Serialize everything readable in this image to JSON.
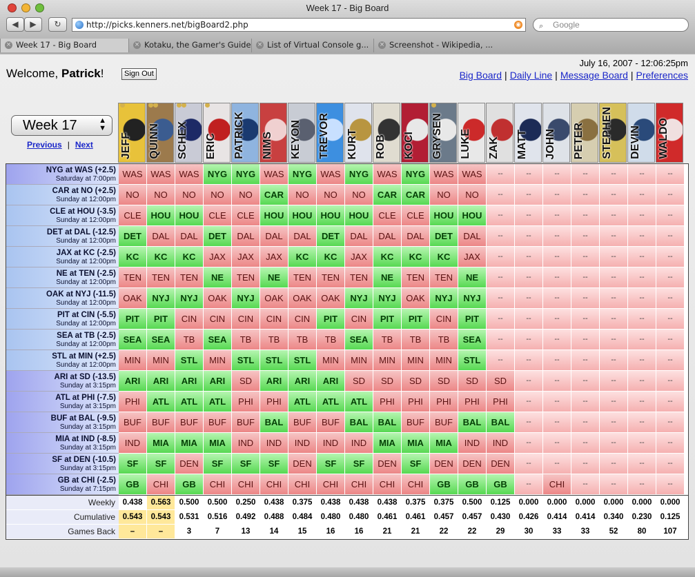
{
  "window": {
    "title": "Week 17 - Big Board"
  },
  "toolbar": {
    "back": "◀",
    "forward": "▶",
    "reload": "↻"
  },
  "address": {
    "url": "http://picks.kenners.net/bigBoard2.php"
  },
  "search": {
    "placeholder": "Google"
  },
  "tabs": [
    {
      "label": "Week 17 - Big Board"
    },
    {
      "label": "Kotaku, the Gamer's Guide"
    },
    {
      "label": "List of Virtual Console g..."
    },
    {
      "label": "Screenshot - Wikipedia, ..."
    }
  ],
  "header": {
    "welcome_prefix": "Welcome, ",
    "user": "Patrick",
    "welcome_suffix": "!",
    "signout": "Sign Out",
    "datetime": "July 16, 2007 - 12:06:25pm",
    "nav": [
      "Big Board",
      "Daily Line",
      "Message Board",
      "Preferences"
    ]
  },
  "week": {
    "selected": "Week 17",
    "prev": "Previous",
    "next": "Next"
  },
  "players": [
    {
      "name": "JEFF",
      "bg": "#e8c23a",
      "accent": "#222222"
    },
    {
      "name": "QUINN",
      "bg": "#9c7a4c",
      "accent": "#3b5c90"
    },
    {
      "name": "SCHEX",
      "bg": "#c9cbd6",
      "accent": "#1d2a66"
    },
    {
      "name": "ERIC",
      "bg": "#e8e4e4",
      "accent": "#c02020"
    },
    {
      "name": "PATRICK",
      "bg": "#8fb4df",
      "accent": "#1a3a70"
    },
    {
      "name": "NIMS",
      "bg": "#c84040",
      "accent": "#f0d0d0"
    },
    {
      "name": "KEYON",
      "bg": "#c8ccd4",
      "accent": "#5a6070"
    },
    {
      "name": "TREVOR",
      "bg": "#3d8fe0",
      "accent": "#c8e0ff"
    },
    {
      "name": "KURT",
      "bg": "#dfe3ec",
      "accent": "#b89540"
    },
    {
      "name": "ROB",
      "bg": "#e0dcd0",
      "accent": "#333333"
    },
    {
      "name": "KOCI",
      "bg": "#b21e34",
      "accent": "#e8e8e8"
    },
    {
      "name": "GRYSEN",
      "bg": "#6b7a8a",
      "accent": "#e8e8e8"
    },
    {
      "name": "LUKE",
      "bg": "#e8e8e8",
      "accent": "#cc2a2a"
    },
    {
      "name": "ZAK",
      "bg": "#e0e0e0",
      "accent": "#c03030"
    },
    {
      "name": "MATT",
      "bg": "#e0e4ec",
      "accent": "#1c2b56"
    },
    {
      "name": "JOHN",
      "bg": "#dee2e8",
      "accent": "#3a4a6c"
    },
    {
      "name": "PETER",
      "bg": "#d6ceb0",
      "accent": "#8a7040"
    },
    {
      "name": "STEPHEN",
      "bg": "#d6c05a",
      "accent": "#2a2a2a"
    },
    {
      "name": "DEVIN",
      "bg": "#d0dcea",
      "accent": "#2a4a7a"
    },
    {
      "name": "WALDO",
      "bg": "#d02a2a",
      "accent": "#f0e0e0"
    }
  ],
  "games": [
    {
      "matchup": "NYG at WAS (+2.5)",
      "time": "Saturday at 7:00pm",
      "picks": [
        "WAS",
        "WAS",
        "WAS",
        "NYG",
        "NYG",
        "WAS",
        "NYG",
        "WAS",
        "NYG",
        "WAS",
        "NYG",
        "WAS",
        "WAS",
        "--",
        "--",
        "--",
        "--",
        "--",
        "--",
        "--"
      ],
      "winner": "NYG"
    },
    {
      "matchup": "CAR at NO (+2.5)",
      "time": "Sunday at 12:00pm",
      "picks": [
        "NO",
        "NO",
        "NO",
        "NO",
        "NO",
        "CAR",
        "NO",
        "NO",
        "NO",
        "CAR",
        "CAR",
        "NO",
        "NO",
        "--",
        "--",
        "--",
        "--",
        "--",
        "--",
        "--"
      ],
      "winner": "CAR"
    },
    {
      "matchup": "CLE at HOU (-3.5)",
      "time": "Sunday at 12:00pm",
      "picks": [
        "CLE",
        "HOU",
        "HOU",
        "CLE",
        "CLE",
        "HOU",
        "HOU",
        "HOU",
        "HOU",
        "CLE",
        "CLE",
        "HOU",
        "HOU",
        "--",
        "--",
        "--",
        "--",
        "--",
        "--",
        "--"
      ],
      "winner": "HOU"
    },
    {
      "matchup": "DET at DAL (-12.5)",
      "time": "Sunday at 12:00pm",
      "picks": [
        "DET",
        "DAL",
        "DAL",
        "DET",
        "DAL",
        "DAL",
        "DAL",
        "DET",
        "DAL",
        "DAL",
        "DAL",
        "DET",
        "DAL",
        "--",
        "--",
        "--",
        "--",
        "--",
        "--",
        "--"
      ],
      "winner": "DET"
    },
    {
      "matchup": "JAX at KC (-2.5)",
      "time": "Sunday at 12:00pm",
      "picks": [
        "KC",
        "KC",
        "KC",
        "JAX",
        "JAX",
        "JAX",
        "KC",
        "KC",
        "JAX",
        "KC",
        "KC",
        "KC",
        "JAX",
        "--",
        "--",
        "--",
        "--",
        "--",
        "--",
        "--"
      ],
      "winner": "KC"
    },
    {
      "matchup": "NE at TEN (-2.5)",
      "time": "Sunday at 12:00pm",
      "picks": [
        "TEN",
        "TEN",
        "TEN",
        "NE",
        "TEN",
        "NE",
        "TEN",
        "TEN",
        "TEN",
        "NE",
        "TEN",
        "TEN",
        "NE",
        "--",
        "--",
        "--",
        "--",
        "--",
        "--",
        "--"
      ],
      "winner": "NE"
    },
    {
      "matchup": "OAK at NYJ (-11.5)",
      "time": "Sunday at 12:00pm",
      "picks": [
        "OAK",
        "NYJ",
        "NYJ",
        "OAK",
        "NYJ",
        "OAK",
        "OAK",
        "OAK",
        "NYJ",
        "NYJ",
        "OAK",
        "NYJ",
        "NYJ",
        "--",
        "--",
        "--",
        "--",
        "--",
        "--",
        "--"
      ],
      "winner": "NYJ"
    },
    {
      "matchup": "PIT at CIN (-5.5)",
      "time": "Sunday at 12:00pm",
      "picks": [
        "PIT",
        "PIT",
        "CIN",
        "CIN",
        "CIN",
        "CIN",
        "CIN",
        "PIT",
        "CIN",
        "PIT",
        "PIT",
        "CIN",
        "PIT",
        "--",
        "--",
        "--",
        "--",
        "--",
        "--",
        "--"
      ],
      "winner": "PIT"
    },
    {
      "matchup": "SEA at TB (-2.5)",
      "time": "Sunday at 12:00pm",
      "picks": [
        "SEA",
        "SEA",
        "TB",
        "SEA",
        "TB",
        "TB",
        "TB",
        "TB",
        "SEA",
        "TB",
        "TB",
        "TB",
        "SEA",
        "--",
        "--",
        "--",
        "--",
        "--",
        "--",
        "--"
      ],
      "winner": "SEA"
    },
    {
      "matchup": "STL at MIN (+2.5)",
      "time": "Sunday at 12:00pm",
      "picks": [
        "MIN",
        "MIN",
        "STL",
        "MIN",
        "STL",
        "STL",
        "STL",
        "MIN",
        "MIN",
        "MIN",
        "MIN",
        "MIN",
        "STL",
        "--",
        "--",
        "--",
        "--",
        "--",
        "--",
        "--"
      ],
      "winner": "STL"
    },
    {
      "matchup": "ARI at SD (-13.5)",
      "time": "Sunday at 3:15pm",
      "picks": [
        "ARI",
        "ARI",
        "ARI",
        "ARI",
        "SD",
        "ARI",
        "ARI",
        "ARI",
        "SD",
        "SD",
        "SD",
        "SD",
        "SD",
        "SD",
        "--",
        "--",
        "--",
        "--",
        "--",
        "--"
      ],
      "winner": "ARI"
    },
    {
      "matchup": "ATL at PHI (-7.5)",
      "time": "Sunday at 3:15pm",
      "picks": [
        "PHI",
        "ATL",
        "ATL",
        "ATL",
        "PHI",
        "PHI",
        "ATL",
        "ATL",
        "ATL",
        "PHI",
        "PHI",
        "PHI",
        "PHI",
        "PHI",
        "--",
        "--",
        "--",
        "--",
        "--",
        "--"
      ],
      "winner": "ATL"
    },
    {
      "matchup": "BUF at BAL (-9.5)",
      "time": "Sunday at 3:15pm",
      "picks": [
        "BUF",
        "BUF",
        "BUF",
        "BUF",
        "BUF",
        "BAL",
        "BUF",
        "BUF",
        "BAL",
        "BAL",
        "BUF",
        "BUF",
        "BAL",
        "BAL",
        "--",
        "--",
        "--",
        "--",
        "--",
        "--"
      ],
      "winner": "BAL"
    },
    {
      "matchup": "MIA at IND (-8.5)",
      "time": "Sunday at 3:15pm",
      "picks": [
        "IND",
        "MIA",
        "MIA",
        "MIA",
        "IND",
        "IND",
        "IND",
        "IND",
        "IND",
        "MIA",
        "MIA",
        "MIA",
        "IND",
        "IND",
        "--",
        "--",
        "--",
        "--",
        "--",
        "--"
      ],
      "winner": "MIA"
    },
    {
      "matchup": "SF at DEN (-10.5)",
      "time": "Sunday at 3:15pm",
      "picks": [
        "SF",
        "SF",
        "DEN",
        "SF",
        "SF",
        "SF",
        "DEN",
        "SF",
        "SF",
        "DEN",
        "SF",
        "DEN",
        "DEN",
        "DEN",
        "--",
        "--",
        "--",
        "--",
        "--",
        "--"
      ],
      "winner": "SF"
    },
    {
      "matchup": "GB at CHI (-2.5)",
      "time": "Sunday at 7:15pm",
      "picks": [
        "GB",
        "CHI",
        "GB",
        "CHI",
        "CHI",
        "CHI",
        "CHI",
        "CHI",
        "CHI",
        "CHI",
        "CHI",
        "GB",
        "GB",
        "GB",
        "--",
        "CHI",
        "--",
        "--",
        "--",
        "--"
      ],
      "winner": "GB"
    }
  ],
  "stats": {
    "weekly_label": "Weekly",
    "cumulative_label": "Cumulative",
    "games_back_label": "Games Back",
    "weekly": [
      "0.438",
      "0.563",
      "0.500",
      "0.500",
      "0.250",
      "0.438",
      "0.375",
      "0.438",
      "0.438",
      "0.438",
      "0.375",
      "0.375",
      "0.500",
      "0.125",
      "0.000",
      "0.000",
      "0.000",
      "0.000",
      "0.000",
      "0.000"
    ],
    "cumulative": [
      "0.543",
      "0.543",
      "0.531",
      "0.516",
      "0.492",
      "0.488",
      "0.484",
      "0.480",
      "0.480",
      "0.461",
      "0.461",
      "0.457",
      "0.457",
      "0.430",
      "0.426",
      "0.414",
      "0.414",
      "0.340",
      "0.230",
      "0.125"
    ],
    "games_back": [
      "–",
      "–",
      "3",
      "7",
      "13",
      "14",
      "15",
      "16",
      "16",
      "21",
      "21",
      "22",
      "22",
      "29",
      "30",
      "33",
      "33",
      "52",
      "80",
      "107"
    ]
  },
  "colors": {
    "win": "#57d952",
    "loss": "#ec8686",
    "highlight": "#ffe89a",
    "link": "#1b27c9"
  }
}
